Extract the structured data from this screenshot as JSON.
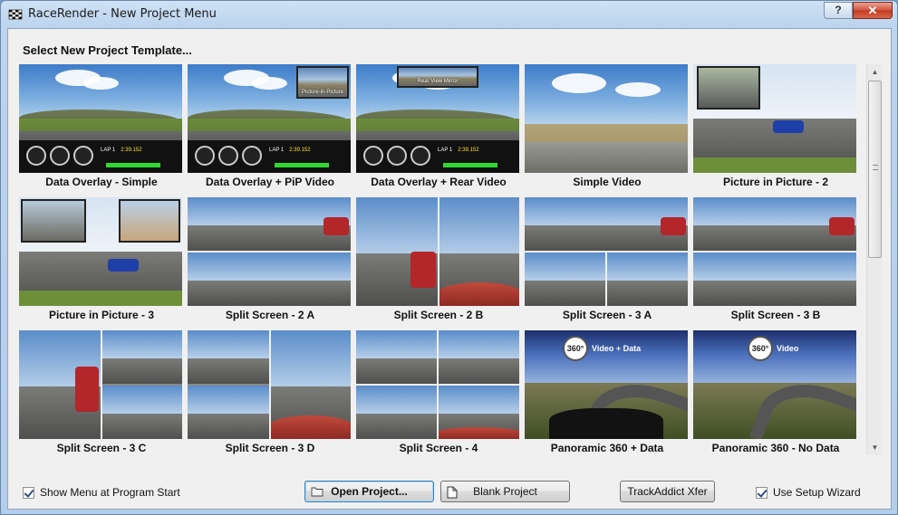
{
  "window": {
    "title": "RaceRender - New Project Menu",
    "help_label": "?",
    "close_label": "✕"
  },
  "heading": "Select New Project Template...",
  "templates": [
    {
      "label": "Data Overlay - Simple",
      "style": "data-overlay"
    },
    {
      "label": "Data Overlay + PiP Video",
      "style": "data-overlay-pip",
      "overlay_text": "Picture-in-Picture"
    },
    {
      "label": "Data Overlay + Rear Video",
      "style": "data-overlay-rear",
      "overlay_text": "Rear View Mirror"
    },
    {
      "label": "Simple Video",
      "style": "simple-video"
    },
    {
      "label": "Picture in Picture - 2",
      "style": "pip-2"
    },
    {
      "label": "Picture in Picture - 3",
      "style": "pip-3"
    },
    {
      "label": "Split Screen - 2 A",
      "style": "split-2a"
    },
    {
      "label": "Split Screen - 2 B",
      "style": "split-2b"
    },
    {
      "label": "Split Screen - 3 A",
      "style": "split-3a"
    },
    {
      "label": "Split Screen - 3 B",
      "style": "split-3b"
    },
    {
      "label": "Split Screen - 3 C",
      "style": "split-3c"
    },
    {
      "label": "Split Screen - 3 D",
      "style": "split-3d"
    },
    {
      "label": "Split Screen - 4",
      "style": "split-4"
    },
    {
      "label": "Panoramic 360 + Data",
      "style": "pano-data",
      "badge": "360°",
      "badge_text": "Video + Data"
    },
    {
      "label": "Panoramic 360 - No Data",
      "style": "pano-nodata",
      "badge": "360°",
      "badge_text": "Video"
    }
  ],
  "overlay_readout": {
    "lap": "LAP 1",
    "time": "2:39.152"
  },
  "footer": {
    "show_menu_label": "Show Menu at Program Start",
    "open_project_label": "Open Project...",
    "blank_project_label": "Blank Project",
    "trackaddict_label": "TrackAddict Xfer",
    "setup_wizard_label": "Use Setup Wizard"
  }
}
